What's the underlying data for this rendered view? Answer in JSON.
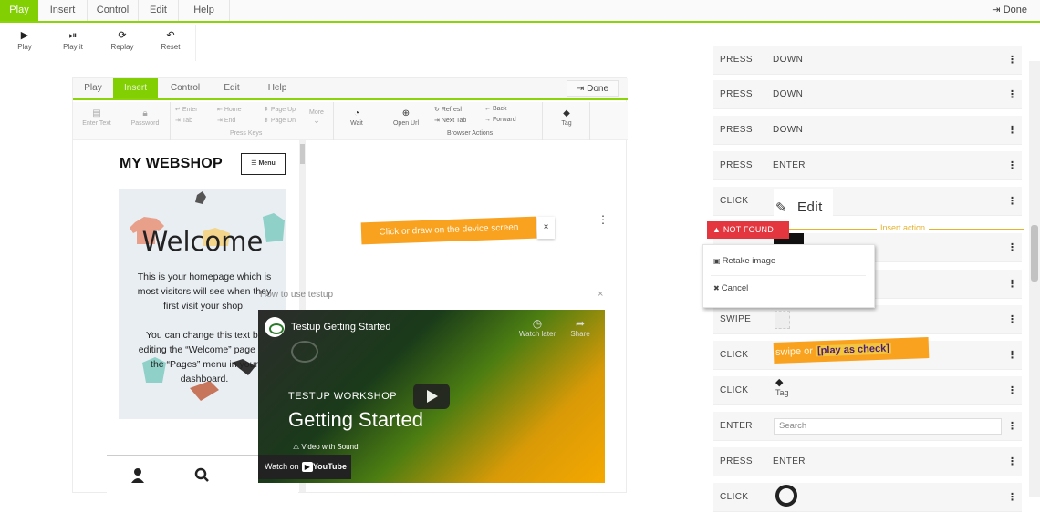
{
  "top_tabs": [
    "Play",
    "Insert",
    "Control",
    "Edit",
    "Help"
  ],
  "top_done": "Done",
  "toolbar": [
    {
      "label": "Play",
      "icon": "▶"
    },
    {
      "label": "Play it",
      "icon": "⏯"
    },
    {
      "label": "Replay",
      "icon": "⟳"
    },
    {
      "label": "Reset",
      "icon": "↶"
    }
  ],
  "inner_tabs": [
    "Play",
    "Insert",
    "Control",
    "Edit",
    "Help"
  ],
  "inner_done": "Done",
  "inner_tools": {
    "enter_text": "Enter Text",
    "password": "Password",
    "keys": {
      "enter": "Enter",
      "tab": "Tab",
      "home": "Home",
      "end": "End",
      "pageup": "Page Up",
      "pagedown": "Page Dn",
      "more": "More",
      "group": "Press Keys"
    },
    "wait": "Wait",
    "open_url": "Open Url",
    "browser": {
      "refresh": "Refresh",
      "next_tab": "Next Tab",
      "back": "Back",
      "forward": "Forward",
      "group": "Browser Actions"
    },
    "tag": "Tag"
  },
  "shop": {
    "title": "MY WEBSHOP",
    "menu": "Menu",
    "welcome": "Welcome",
    "text1": "This is your homepage which is most visitors will see when they first visit your shop.",
    "text2": "You can change this text by editing the “Welcome” page via the “Pages” menu in your dashboard."
  },
  "hint": "Click or draw on the device screen",
  "hint_close": "×",
  "video": {
    "caption": "How to use testup",
    "close": "×",
    "title": "Testup Getting Started",
    "watch_later": "Watch later",
    "share": "Share",
    "workshop": "TESTUP WORKSHOP",
    "heading": "Getting Started",
    "sound": "Video with Sound!",
    "watch_on": "Watch on",
    "youtube": "YouTube"
  },
  "steps": [
    {
      "action": "PRESS",
      "value": "DOWN"
    },
    {
      "action": "PRESS",
      "value": "DOWN"
    },
    {
      "action": "PRESS",
      "value": "DOWN"
    },
    {
      "action": "PRESS",
      "value": "ENTER"
    },
    {
      "action": "CLICK",
      "value": ""
    },
    {
      "action": "",
      "value": ""
    },
    {
      "action": "",
      "value": ""
    },
    {
      "action": "SWIPE",
      "value": ""
    },
    {
      "action": "CLICK",
      "value": ""
    },
    {
      "action": "CLICK",
      "value": ""
    },
    {
      "action": "ENTER",
      "value": ""
    },
    {
      "action": "PRESS",
      "value": "ENTER"
    },
    {
      "action": "CLICK",
      "value": ""
    }
  ],
  "edit_image_label": "Edit",
  "not_found": "NOT FOUND",
  "insert_action": "Insert action",
  "popup": {
    "retake": "Retake image",
    "cancel": "Cancel"
  },
  "swipe_note": {
    "before": "swipe or ",
    "highlight": "[play as check]"
  },
  "tag_label": "Tag",
  "search_placeholder": "Search",
  "accent_color": "#82cf04",
  "error_color": "#e3363f",
  "highlight_color": "#f8a21f"
}
